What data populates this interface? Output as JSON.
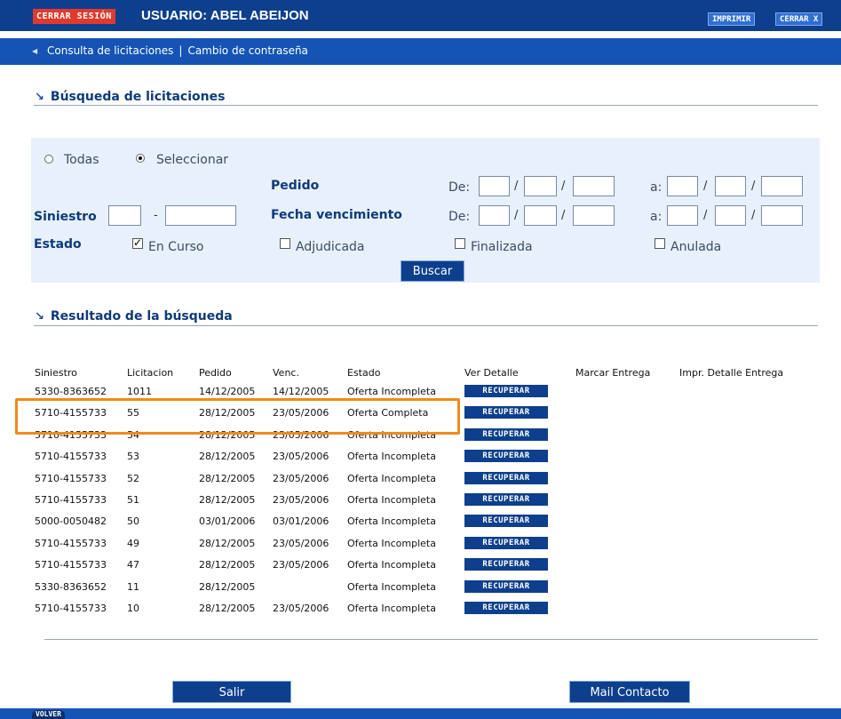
{
  "header": {
    "logout_label": "CERRAR SESIÓN",
    "user_label": "USUARIO: ABEL ABEIJON",
    "print_label": "IMPRIMIR",
    "close_label": "CERRAR X"
  },
  "nav": {
    "consulta": "Consulta de licitaciones",
    "separator": "|",
    "cambio": "Cambio de contraseña"
  },
  "search": {
    "title": "Búsqueda de licitaciones",
    "radio_todas": "Todas",
    "radio_seleccionar": "Seleccionar",
    "selected_radio": "Seleccionar",
    "pedido_label": "Pedido",
    "siniestro_label": "Siniestro",
    "siniestro_dash": "-",
    "fecha_label": "Fecha vencimiento",
    "de_label": "De:",
    "a_label": "a:",
    "date_sep": "/",
    "estado_label": "Estado",
    "estado_options": [
      {
        "label": "En Curso",
        "checked": true
      },
      {
        "label": "Adjudicada",
        "checked": false
      },
      {
        "label": "Finalizada",
        "checked": false
      },
      {
        "label": "Anulada",
        "checked": false
      }
    ],
    "buscar_label": "Buscar"
  },
  "results": {
    "title": "Resultado de la búsqueda",
    "columns": [
      "Siniestro",
      "Licitacion",
      "Pedido",
      "Venc.",
      "Estado",
      "Ver Detalle",
      "Marcar Entrega",
      "Impr. Detalle Entrega"
    ],
    "action_label": "RECUPERAR",
    "highlighted_row": 1,
    "rows": [
      {
        "siniestro": "5330-8363652",
        "licitacion": "1011",
        "pedido": "14/12/2005",
        "venc": "14/12/2005",
        "estado": "Oferta Incompleta"
      },
      {
        "siniestro": "5710-4155733",
        "licitacion": "55",
        "pedido": "28/12/2005",
        "venc": "23/05/2006",
        "estado": "Oferta Completa"
      },
      {
        "siniestro": "5710-4155733",
        "licitacion": "54",
        "pedido": "28/12/2005",
        "venc": "23/05/2006",
        "estado": "Oferta Incompleta"
      },
      {
        "siniestro": "5710-4155733",
        "licitacion": "53",
        "pedido": "28/12/2005",
        "venc": "23/05/2006",
        "estado": "Oferta Incompleta"
      },
      {
        "siniestro": "5710-4155733",
        "licitacion": "52",
        "pedido": "28/12/2005",
        "venc": "23/05/2006",
        "estado": "Oferta Incompleta"
      },
      {
        "siniestro": "5710-4155733",
        "licitacion": "51",
        "pedido": "28/12/2005",
        "venc": "23/05/2006",
        "estado": "Oferta Incompleta"
      },
      {
        "siniestro": "5000-0050482",
        "licitacion": "50",
        "pedido": "03/01/2006",
        "venc": "03/01/2006",
        "estado": "Oferta Incompleta"
      },
      {
        "siniestro": "5710-4155733",
        "licitacion": "49",
        "pedido": "28/12/2005",
        "venc": "23/05/2006",
        "estado": "Oferta Incompleta"
      },
      {
        "siniestro": "5710-4155733",
        "licitacion": "47",
        "pedido": "28/12/2005",
        "venc": "23/05/2006",
        "estado": "Oferta Incompleta"
      },
      {
        "siniestro": "5330-8363652",
        "licitacion": "11",
        "pedido": "28/12/2005",
        "venc": "",
        "estado": "Oferta Incompleta"
      },
      {
        "siniestro": "5710-4155733",
        "licitacion": "10",
        "pedido": "28/12/2005",
        "venc": "23/05/2006",
        "estado": "Oferta Incompleta"
      }
    ]
  },
  "footer": {
    "salir_label": "Salir",
    "mail_label": "Mail Contacto",
    "volver_label": "VOLVER"
  },
  "colors": {
    "header_bg": "#0d3f8c",
    "nav_bg": "#1553b5",
    "logout_bg": "#e03a2e",
    "panel_bg": "#e7f0fb",
    "highlight_border": "#f08a1c"
  }
}
